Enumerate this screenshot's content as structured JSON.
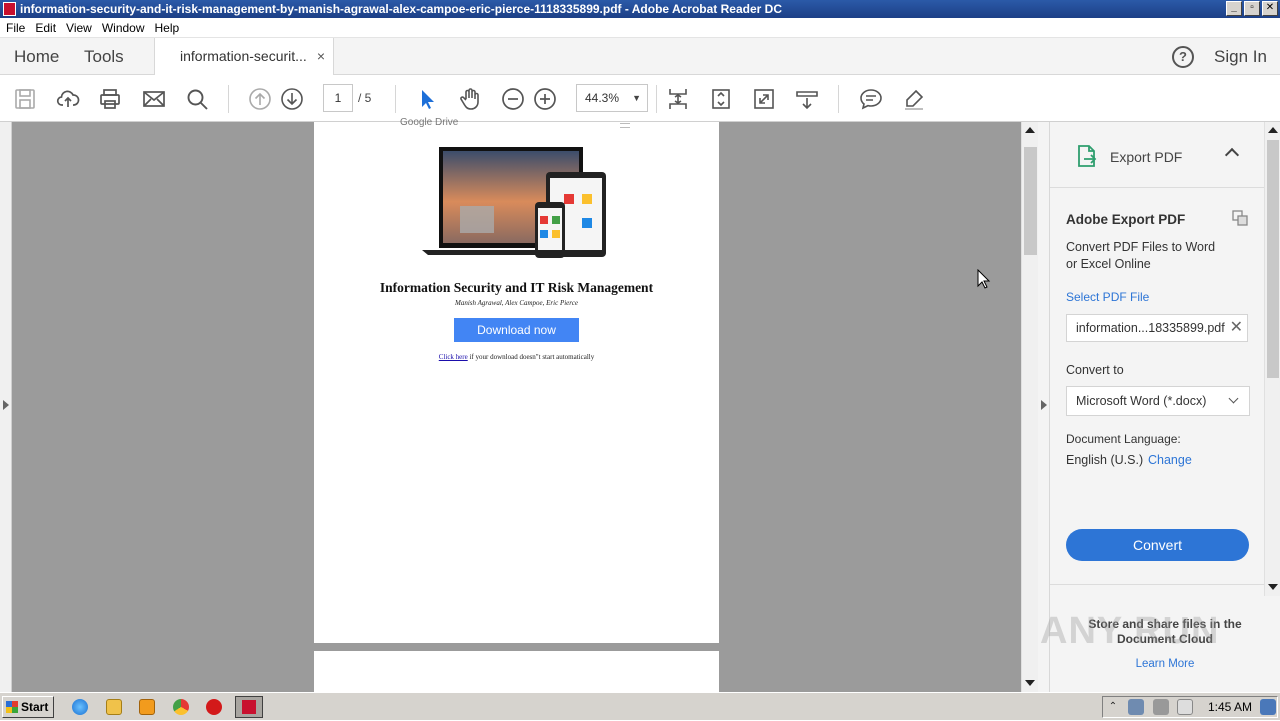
{
  "window": {
    "title": "information-security-and-it-risk-management-by-manish-agrawal-alex-campoe-eric-pierce-1118335899.pdf - Adobe Acrobat Reader DC",
    "controls": [
      "_",
      "▫",
      "✕"
    ]
  },
  "menu": [
    "File",
    "Edit",
    "View",
    "Window",
    "Help"
  ],
  "tabs": {
    "home": "Home",
    "tools": "Tools",
    "document": "information-securit...",
    "close": "×",
    "sign_in": "Sign In",
    "help": "?"
  },
  "toolbar": {
    "page_current": "1",
    "page_total": "/ 5",
    "zoom": "44.3%",
    "icons": [
      "save-icon",
      "upload-icon",
      "print-icon",
      "email-icon",
      "search-icon",
      "prev-page-icon",
      "next-page-icon",
      "select-arrow-icon",
      "hand-icon",
      "zoom-out-icon",
      "zoom-in-icon",
      "fit-page-icon",
      "rotate-icon",
      "full-screen-icon",
      "scroll-mode-icon",
      "comment-icon",
      "highlight-icon"
    ]
  },
  "pdf_page": {
    "brand": "Google Drive",
    "title": "Information Security and IT Risk Management",
    "authors": "Manish Agrawal, Alex Campoe, Eric Pierce",
    "download_button": "Download now",
    "click_here": "Click here",
    "click_rest": " if your download doesn\"t start automatically"
  },
  "right_panel": {
    "header": "Export PDF",
    "card_title": "Adobe Export PDF",
    "description_line1": "Convert PDF Files to Word",
    "description_line2": "or Excel Online",
    "select_file_label": "Select PDF File",
    "file_name": "information...18335899.pdf",
    "convert_to_label": "Convert to",
    "convert_to_value": "Microsoft Word (*.docx)",
    "language_label": "Document Language:",
    "language_value": "English (U.S.)",
    "language_change": "Change",
    "convert_button": "Convert",
    "store_text": "Store and share files in the Document Cloud",
    "learn_more": "Learn More",
    "accent_color": "#2d75d6"
  },
  "taskbar": {
    "start": "Start",
    "clock": "1:45 AM"
  },
  "watermark": "ANY RUN"
}
